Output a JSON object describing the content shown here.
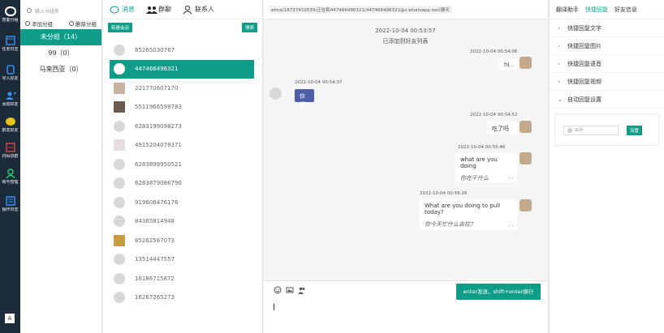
{
  "colors": {
    "accent": "#0f9d8a",
    "rail": "#1c2b3a",
    "incoming_bubble": "#4d5ea8"
  },
  "rail": {
    "items": [
      {
        "icon": "chat-bubble-icon",
        "label": "智能分组"
      },
      {
        "icon": "calendar-icon",
        "label": "任务日志"
      },
      {
        "icon": "phone-icon",
        "label": "导入好友"
      },
      {
        "icon": "add-user-icon",
        "label": "添加好友"
      },
      {
        "icon": "message-icon",
        "label": "群发好友"
      },
      {
        "icon": "scan-icon",
        "label": "扫码进群"
      },
      {
        "icon": "account-icon",
        "label": "账号管理"
      },
      {
        "icon": "log-icon",
        "label": "操作日志"
      }
    ],
    "bottom_icon": "translate-icon",
    "bottom_label": "A"
  },
  "groups": {
    "search_placeholder": "输入分组名",
    "add_label": "添加分组",
    "delete_label": "删除分组",
    "items": [
      {
        "label": "未分组（14）"
      },
      {
        "label": "99（0）"
      },
      {
        "label": "马来西亚（0）"
      }
    ]
  },
  "contacts": {
    "tabs": [
      {
        "label": "消息",
        "icon": "chat-icon"
      },
      {
        "label": "群聊",
        "icon": "group-icon"
      },
      {
        "label": "联系人",
        "icon": "person-icon"
      }
    ],
    "new_chat_label": "新建会话",
    "search_label": "搜索",
    "items": [
      {
        "number": "85265030767"
      },
      {
        "number": "447466496321"
      },
      {
        "number": "221770607170"
      },
      {
        "number": "5511966598783"
      },
      {
        "number": "6283199098273"
      },
      {
        "number": "4915204078371"
      },
      {
        "number": "6283899950521"
      },
      {
        "number": "6283879086790"
      },
      {
        "number": "919608476176"
      },
      {
        "number": "84365814948"
      },
      {
        "number": "85262567073"
      },
      {
        "number": "13514447557"
      },
      {
        "number": "16186715872"
      },
      {
        "number": "16267265273"
      }
    ]
  },
  "chat": {
    "header": "elma(18737410539)正在和447466496321(447466496321@s.whatsapp.net)聊天",
    "system_time": "2022-10-04 00:53:57",
    "system_note": "已添加到好友列表",
    "messages": [
      {
        "time": "2022-10-04 00:54:06",
        "text": "hi",
        "translation": ""
      },
      {
        "time": "2022-10-04 00:54:37",
        "text": "你好",
        "translation": ""
      },
      {
        "time": "2022-10-04 00:54:52",
        "text": "吃了吗",
        "translation": ""
      },
      {
        "time": "2022-10-04 00:55:46",
        "text": "what are you doing",
        "translation": "你在干什么"
      },
      {
        "time": "2022-10-04 00:56:26",
        "text": "What are you doing to pull today?",
        "translation": "你今天忙什么去拉？"
      }
    ],
    "send_label": "enter发送，shift+enter换行",
    "input_value": ""
  },
  "right": {
    "tabs": [
      {
        "label": "翻译助手"
      },
      {
        "label": "快捷回复"
      },
      {
        "label": "好友信息"
      }
    ],
    "items": [
      {
        "label": "快捷回复文字"
      },
      {
        "label": "快捷回复图片"
      },
      {
        "label": "快捷回复语音"
      },
      {
        "label": "快捷回复视频"
      },
      {
        "label": "自动回复设置"
      }
    ],
    "toggle_label": "关闭",
    "settings_label": "设置"
  }
}
